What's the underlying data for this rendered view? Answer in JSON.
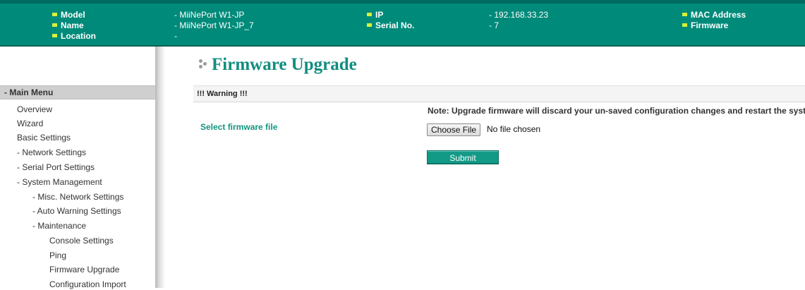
{
  "header": {
    "model_label": "Model",
    "model_value": "- MiiNePort W1-JP",
    "name_label": "Name",
    "name_value": "- MiiNePort W1-JP_7",
    "location_label": "Location",
    "location_value": "-",
    "ip_label": "IP",
    "ip_value": "- 192.168.33.23",
    "serial_label": "Serial No.",
    "serial_value": "- 7",
    "mac_label": "MAC Address",
    "firmware_label": "Firmware",
    "bullet_color": "#d9f03c",
    "background_color": "#008a7a"
  },
  "sidebar": {
    "menu_title": "- Main Menu",
    "items": [
      "Overview",
      "Wizard",
      "Basic Settings",
      "- Network Settings",
      "- Serial Port Settings",
      "- System Management",
      "- Misc. Network Settings",
      "- Auto Warning Settings",
      "- Maintenance",
      "Console Settings",
      "Ping",
      "Firmware Upgrade",
      "Configuration Import"
    ]
  },
  "main": {
    "title": "Firmware Upgrade",
    "warning": "!!! Warning !!!",
    "note": "Note: Upgrade firmware will discard your un-saved configuration changes and restart the system!",
    "field_label": "Select firmware file",
    "choose_file_label": "Choose File",
    "file_status": "No file chosen",
    "submit_label": "Submit",
    "accent_color": "#118d7f"
  }
}
